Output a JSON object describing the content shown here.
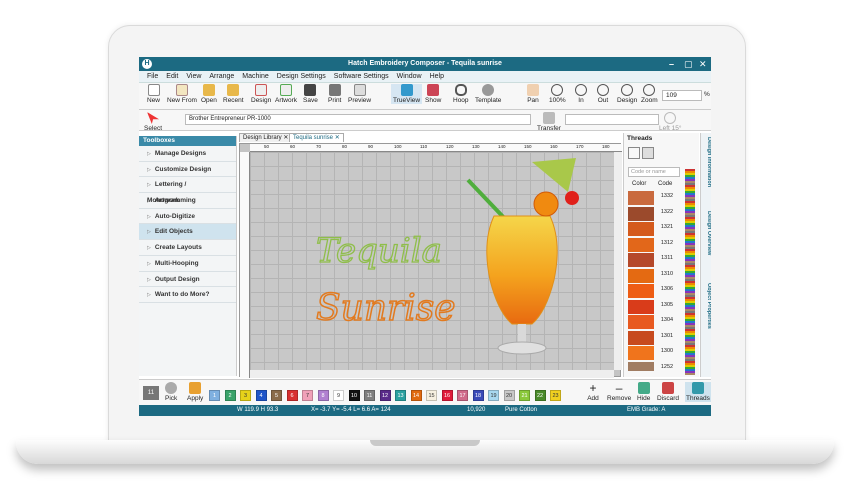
{
  "window": {
    "title": "Hatch Embroidery Composer - Tequila sunrise",
    "logo": "H",
    "controls": [
      "–",
      "▢",
      "✕"
    ]
  },
  "menu": [
    "File",
    "Edit",
    "View",
    "Arrange",
    "Machine",
    "Design Settings",
    "Software Settings",
    "Window",
    "Help"
  ],
  "toolbar": {
    "items": [
      {
        "label": "New",
        "icon": "new-file-icon"
      },
      {
        "label": "New From",
        "icon": "new-from-icon"
      },
      {
        "label": "Open",
        "icon": "folder-icon"
      },
      {
        "label": "Recent",
        "icon": "recent-folder-icon"
      },
      {
        "label": "Design",
        "icon": "design-icon"
      },
      {
        "label": "Artwork",
        "icon": "artwork-icon"
      },
      {
        "label": "Save",
        "icon": "save-icon"
      },
      {
        "label": "Print",
        "icon": "print-icon"
      },
      {
        "label": "Preview",
        "icon": "preview-icon"
      },
      {
        "label": "TrueView",
        "icon": "trueview-icon"
      },
      {
        "label": "Show",
        "icon": "show-icon"
      },
      {
        "label": "Hoop",
        "icon": "hoop-icon"
      },
      {
        "label": "Template",
        "icon": "template-icon"
      },
      {
        "label": "Pan",
        "icon": "hand-icon"
      },
      {
        "label": "100%",
        "icon": "zoom-100-icon"
      },
      {
        "label": "In",
        "icon": "zoom-in-icon"
      },
      {
        "label": "Out",
        "icon": "zoom-out-icon"
      },
      {
        "label": "Design",
        "icon": "zoom-design-icon"
      },
      {
        "label": "Zoom",
        "icon": "zoom-icon"
      }
    ],
    "zoom_value": "109",
    "zoom_unit": "%"
  },
  "toolbar2": {
    "select_label": "Select",
    "machine": "Brother Entrepreneur PR-1000",
    "transfer_label": "Transfer",
    "left_label": "Left 15°"
  },
  "toolboxes": {
    "title": "Toolboxes",
    "items": [
      "Manage Designs",
      "Customize Design",
      "Lettering / Monogramming",
      "Artwork",
      "Auto-Digitize",
      "Edit Objects",
      "Create Layouts",
      "Multi-Hooping",
      "Output Design",
      "Want to do More?"
    ],
    "active_index": 5
  },
  "tabs": [
    {
      "label": "Design Library",
      "close": "✕"
    },
    {
      "label": "Tequila sunrise",
      "close": "✕"
    }
  ],
  "ruler": {
    "h": [
      "50",
      "60",
      "70",
      "80",
      "90",
      "100",
      "110",
      "120",
      "130",
      "140",
      "150",
      "160",
      "170",
      "180"
    ],
    "v": [
      "50",
      "60",
      "70",
      "80",
      "90",
      "100",
      "110",
      "120",
      "130",
      "140"
    ]
  },
  "design": {
    "line1": "Tequila",
    "line2": "Sunrise",
    "line1_color": "#8fbe4a",
    "line2_color": "#e27a1f"
  },
  "threads": {
    "title": "Threads",
    "search_placeholder": "Code or name",
    "col_color": "Color",
    "col_code": "Code",
    "rows": [
      {
        "code": "1332",
        "color": "#c96a3e"
      },
      {
        "code": "1322",
        "color": "#9b4a2c"
      },
      {
        "code": "1321",
        "color": "#d45a1c"
      },
      {
        "code": "1312",
        "color": "#e2671a"
      },
      {
        "code": "1311",
        "color": "#b5492a"
      },
      {
        "code": "1310",
        "color": "#e46a12"
      },
      {
        "code": "1306",
        "color": "#ee5d14"
      },
      {
        "code": "1305",
        "color": "#d93c1a"
      },
      {
        "code": "1304",
        "color": "#e85a20"
      },
      {
        "code": "1301",
        "color": "#c74a1e"
      },
      {
        "code": "1300",
        "color": "#f0741c"
      },
      {
        "code": "1252",
        "color": "#a07c62"
      }
    ]
  },
  "side_tabs": [
    "Design Information",
    "Design Overview",
    "Object Properties"
  ],
  "bottom": {
    "current_num": "11",
    "pick_label": "Pick",
    "apply_label": "Apply",
    "swatches": [
      {
        "n": "1",
        "c": "#7fb0e0"
      },
      {
        "n": "2",
        "c": "#3aa36a"
      },
      {
        "n": "3",
        "c": "#e6d21a"
      },
      {
        "n": "4",
        "c": "#1f55c8"
      },
      {
        "n": "5",
        "c": "#8a6b4a"
      },
      {
        "n": "6",
        "c": "#d83030"
      },
      {
        "n": "7",
        "c": "#f0a0b8"
      },
      {
        "n": "8",
        "c": "#b080d0"
      },
      {
        "n": "9",
        "c": "#ffffff"
      },
      {
        "n": "10",
        "c": "#111111"
      },
      {
        "n": "11",
        "c": "#808080"
      },
      {
        "n": "12",
        "c": "#5a2a8a"
      },
      {
        "n": "13",
        "c": "#2aa0a0"
      },
      {
        "n": "14",
        "c": "#e06a10"
      },
      {
        "n": "15",
        "c": "#f6f0e0"
      },
      {
        "n": "16",
        "c": "#e01a3a"
      },
      {
        "n": "17",
        "c": "#d06a8a"
      },
      {
        "n": "18",
        "c": "#3a4ab8"
      },
      {
        "n": "19",
        "c": "#a8d8f0"
      },
      {
        "n": "20",
        "c": "#c8c8c8"
      },
      {
        "n": "21",
        "c": "#8ac83a"
      },
      {
        "n": "22",
        "c": "#4a8a2a"
      },
      {
        "n": "23",
        "c": "#f0d020"
      }
    ],
    "add_label": "Add",
    "remove_label": "Remove",
    "hide_label": "Hide",
    "discard_label": "Discard",
    "threads_label": "Threads"
  },
  "status": {
    "size": "W 119.9 H 93.3",
    "coords": "X=  -3.7 Y= -5.4 L= 6.6 A= 124",
    "stitches": "10,920",
    "fabric": "Pure Cotton",
    "grade": "EMB Grade: A"
  }
}
